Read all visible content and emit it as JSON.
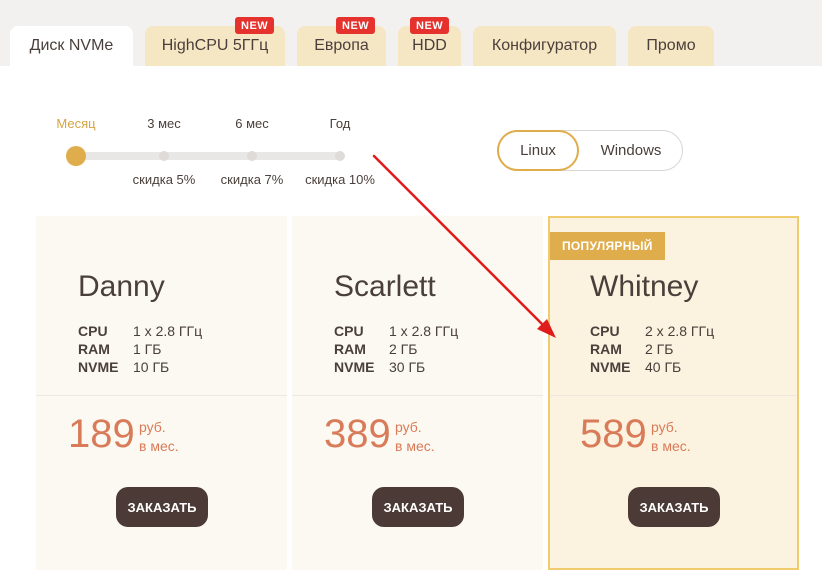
{
  "tabs": [
    {
      "label": "Диск NVMe",
      "active": true,
      "badge": ""
    },
    {
      "label": "HighCPU 5ГГц",
      "active": false,
      "badge": "NEW"
    },
    {
      "label": "Европа",
      "active": false,
      "badge": "NEW"
    },
    {
      "label": "HDD",
      "active": false,
      "badge": "NEW"
    },
    {
      "label": "Конфигуратор",
      "active": false,
      "badge": ""
    },
    {
      "label": "Промо",
      "active": false,
      "badge": ""
    }
  ],
  "period": {
    "options": [
      "Месяц",
      "3 мес",
      "6 мес",
      "Год"
    ],
    "discounts": [
      "скидка 5%",
      "скидка 7%",
      "скидка 10%"
    ],
    "selected": "Месяц"
  },
  "os": {
    "options": [
      "Linux",
      "Windows"
    ],
    "selected": "Linux"
  },
  "plans": [
    {
      "name": "Danny",
      "specs": [
        {
          "key": "CPU",
          "value": "1 x 2.8 ГГц"
        },
        {
          "key": "RAM",
          "value": "1 ГБ"
        },
        {
          "key": "NVME",
          "value": "10 ГБ"
        }
      ],
      "price": "189",
      "currency": "руб.",
      "period": "в мес.",
      "order_label": "ЗАКАЗАТЬ",
      "badge": ""
    },
    {
      "name": "Scarlett",
      "specs": [
        {
          "key": "CPU",
          "value": "1 x 2.8 ГГц"
        },
        {
          "key": "RAM",
          "value": "2 ГБ"
        },
        {
          "key": "NVME",
          "value": "30 ГБ"
        }
      ],
      "price": "389",
      "currency": "руб.",
      "period": "в мес.",
      "order_label": "ЗАКАЗАТЬ",
      "badge": ""
    },
    {
      "name": "Whitney",
      "specs": [
        {
          "key": "CPU",
          "value": "2 x 2.8 ГГц"
        },
        {
          "key": "RAM",
          "value": "2 ГБ"
        },
        {
          "key": "NVME",
          "value": "40 ГБ"
        }
      ],
      "price": "589",
      "currency": "руб.",
      "period": "в мес.",
      "order_label": "ЗАКАЗАТЬ",
      "badge": "ПОПУЛЯРНЫЙ"
    }
  ],
  "colors": {
    "accent": "#e0ad4c",
    "price": "#d97b59",
    "button": "#4b3a35",
    "new_badge": "#e5322d",
    "annotation_arrow": "#e01b1b"
  }
}
